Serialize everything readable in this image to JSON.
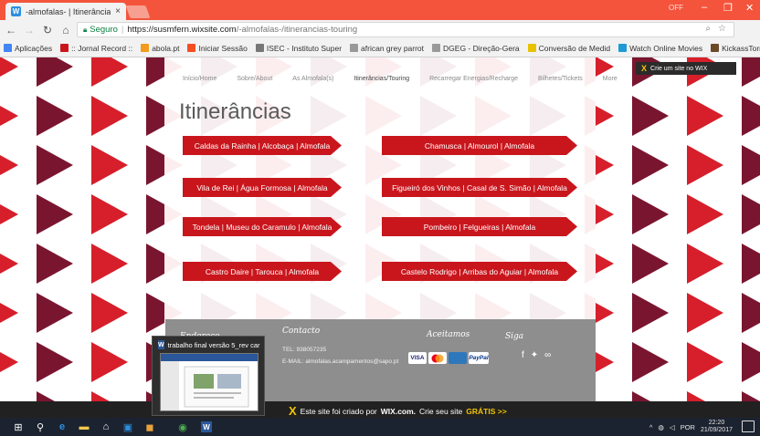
{
  "browser": {
    "tab_title": "-almofalas- | Itinerâncias",
    "tab_close": "×",
    "profile_badge": "OFF",
    "address": {
      "secure_label": "Seguro",
      "url_host": "https://susmfern.wixsite.com",
      "url_path": "/-almofalas-/itinerancias-touring"
    },
    "bookmarks": [
      {
        "label": "Aplicações",
        "color": "#4285f4"
      },
      {
        "label": ":: Jornal Record ::",
        "color": "#c9161d"
      },
      {
        "label": "abola.pt",
        "color": "#f29b1d"
      },
      {
        "label": "Iniciar Sessão",
        "color": "#f25022"
      },
      {
        "label": "ISEC - Instituto Super",
        "color": "#777777"
      },
      {
        "label": "african grey parrot",
        "color": "#999999"
      },
      {
        "label": "DGEG - Direção-Gera",
        "color": "#999999"
      },
      {
        "label": "Conversão de Medid",
        "color": "#e8c100"
      },
      {
        "label": "Watch Online Movies",
        "color": "#1d9bd6"
      },
      {
        "label": "KickassTorrents - Do",
        "color": "#6b4a2b"
      }
    ],
    "bookmarks_more": "»"
  },
  "site": {
    "nav": [
      "Início/Home",
      "Sobre/About",
      "As Almofala(s)",
      "Itinerâncias/Touring",
      "Recarregar Energias/Recharge",
      "Bilhetes/Tickets",
      "More"
    ],
    "nav_active_index": 3,
    "wix_tag": "Crie um site no WIX",
    "title": "Itinerâncias",
    "routes": [
      "Caldas da Rainha | Alcobaça | Almofala",
      "Chamusca | Almourol | Almofala",
      "Vila de Rei | Água Formosa | Almofala",
      "Figueiró dos Vinhos | Casal de S. Simão | Almofala",
      "Tondela | Museu do Caramulo | Almofala",
      "Pombeiro | Felgueiras | Almofala",
      "Castro Daire | Tarouca | Almofala",
      "Castelo Rodrigo | Arribas do Aguiar | Almofala"
    ],
    "route_color": "#c9161d",
    "footer": {
      "endereco_heading": "Endereço",
      "contacto_heading": "Contacto",
      "contacto_tel": "TEL: 938057235",
      "contacto_email": "E-MAIL: almofalas.acampamentos@sapo.pt",
      "aceitamos_heading": "Aceitamos",
      "payments": [
        "VISA",
        "",
        "",
        "PayPal"
      ],
      "siga_heading": "Siga",
      "social": [
        "f",
        "✦",
        "∞"
      ]
    }
  },
  "wix_banner": {
    "text": "Este site foi criado por",
    "brand": "WIX.com.",
    "text2": "Crie seu site",
    "cta": "GRÁTIS >>"
  },
  "taskbar": {
    "thumbnail_title": "trabalho final versão 5_rev carla...",
    "language": "POR",
    "time": "22:20",
    "date": "21/09/2017"
  }
}
